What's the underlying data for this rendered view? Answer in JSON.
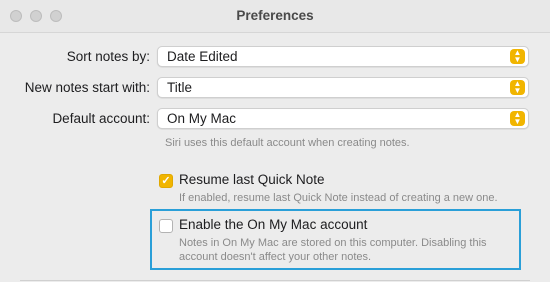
{
  "window": {
    "title": "Preferences"
  },
  "settings": {
    "sort_notes": {
      "label": "Sort notes by:",
      "value": "Date Edited"
    },
    "new_notes": {
      "label": "New notes start with:",
      "value": "Title"
    },
    "default_account": {
      "label": "Default account:",
      "value": "On My Mac",
      "hint": "Siri uses this default account when creating notes."
    }
  },
  "options": {
    "resume_quick_note": {
      "label": "Resume last Quick Note",
      "checked": true,
      "description": "If enabled, resume last Quick Note instead of creating a new one."
    },
    "enable_on_my_mac": {
      "label": "Enable the On My Mac account",
      "checked": false,
      "description_line1": "Notes in On My Mac are stored on this computer. Disabling this",
      "description_line2": "account doesn't affect your other notes."
    }
  },
  "colors": {
    "accent": "#f1b500",
    "highlight_border": "#2a9fd8"
  },
  "icons": {
    "select_arrows": "chevron-up-down-icon",
    "checkmark": "checkmark-icon"
  }
}
